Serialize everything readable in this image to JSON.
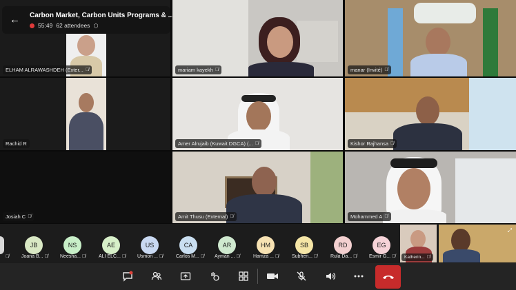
{
  "meeting": {
    "title": "Carbon Market, Carbon Units Programs & ...",
    "duration": "55:49",
    "attendees": "62 attendees"
  },
  "tiles": [
    {
      "name": "ELHAM ALRAWASHDEH (Exter...",
      "muted": true
    },
    {
      "name": "mariam kayekh",
      "muted": true
    },
    {
      "name": "manar (Invité)",
      "muted": true
    },
    {
      "name": "Rachid R",
      "muted": false
    },
    {
      "name": "Amer Alrujaib (Kuwait DGCA) (...",
      "muted": true
    },
    {
      "name": "Kishor Rajhansa",
      "muted": true
    },
    {
      "name": "Josiah C",
      "muted": true
    },
    {
      "name": "Amit Thusu (External)",
      "muted": true
    },
    {
      "name": "Mohammed A",
      "muted": true
    }
  ],
  "strip": [
    {
      "initials": "JB",
      "name": "Joana B...",
      "color": "#d9e8c4"
    },
    {
      "initials": "NS",
      "name": "Neesha...",
      "color": "#c8efc8"
    },
    {
      "initials": "AE",
      "name": "ALI ELC...",
      "color": "#d7f0c9"
    },
    {
      "initials": "US",
      "name": "Usmon ...",
      "color": "#c9d9f2"
    },
    {
      "initials": "CA",
      "name": "Carlos M...",
      "color": "#c9def0"
    },
    {
      "initials": "AR",
      "name": "Ayman ...",
      "color": "#cfe9cf"
    },
    {
      "initials": "HM",
      "name": "Hamza ...",
      "color": "#f7e2b3"
    },
    {
      "initials": "SB",
      "name": "Subhen...",
      "color": "#f5e5a6"
    },
    {
      "initials": "RD",
      "name": "Rula Da...",
      "color": "#f3d0d0"
    },
    {
      "initials": "EG",
      "name": "Esmir G...",
      "color": "#f6d3d8"
    }
  ],
  "strip_video": {
    "name": "Katherin..."
  },
  "toolbar": {
    "chat": "chat-icon",
    "people": "people-icon",
    "share": "share-icon",
    "react": "react-icon",
    "layout": "layout-icon",
    "camera": "camera-icon",
    "mic": "mic-off-icon",
    "speaker": "speaker-icon",
    "more": "more-icon",
    "end": "end-call-icon"
  }
}
